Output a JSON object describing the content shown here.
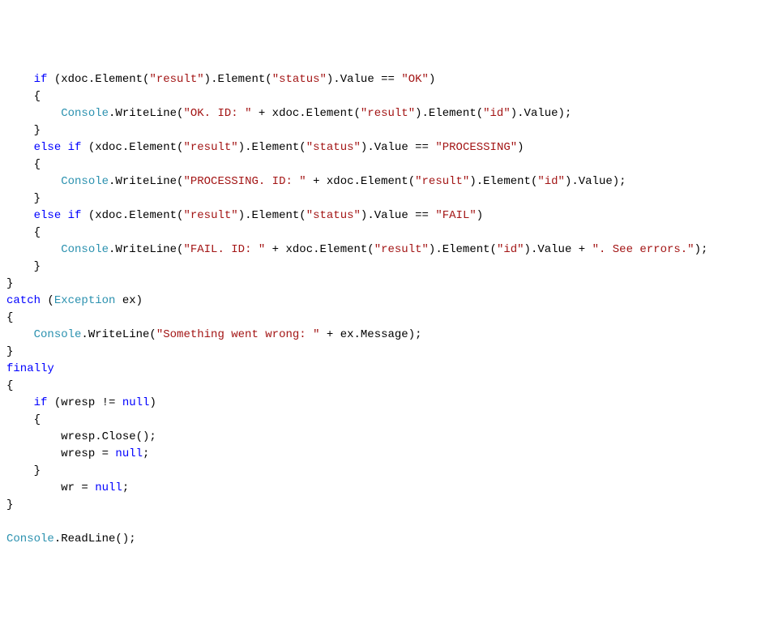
{
  "code": {
    "c": {
      "kw_if": "if",
      "kw_else": "else",
      "kw_catch": "catch",
      "kw_finally": "finally",
      "kw_null": "null",
      "type_exception": "Exception",
      "type_console": "Console"
    },
    "l1_a": " (xdoc.Element(",
    "l1_s1": "\"result\"",
    "l1_b": ").Element(",
    "l1_s2": "\"status\"",
    "l1_c": ").Value == ",
    "l1_s3": "\"OK\"",
    "l1_d": ")",
    "l2": "    {",
    "l3_a": "        ",
    "l3_b": ".WriteLine(",
    "l3_s1": "\"OK. ID: \"",
    "l3_c": " + xdoc.Element(",
    "l3_s2": "\"result\"",
    "l3_d": ").Element(",
    "l3_s3": "\"id\"",
    "l3_e": ").Value);",
    "l4": "    }",
    "l5_a": "    ",
    "l5_b": " ",
    "l5_c": " (xdoc.Element(",
    "l5_s1": "\"result\"",
    "l5_d": ").Element(",
    "l5_s2": "\"status\"",
    "l5_e": ").Value == ",
    "l5_s3": "\"PROCESSING\"",
    "l5_f": ")",
    "l6": "    {",
    "l7_a": "        ",
    "l7_b": ".WriteLine(",
    "l7_s1": "\"PROCESSING. ID: \"",
    "l7_c": " + xdoc.Element(",
    "l7_s2": "\"result\"",
    "l7_d": ").Element(",
    "l7_s3": "\"id\"",
    "l7_e": ").Value);",
    "l8": "    }",
    "l9_a": "    ",
    "l9_b": " ",
    "l9_c": " (xdoc.Element(",
    "l9_s1": "\"result\"",
    "l9_d": ").Element(",
    "l9_s2": "\"status\"",
    "l9_e": ").Value == ",
    "l9_s3": "\"FAIL\"",
    "l9_f": ")",
    "l10": "    {",
    "l11_a": "        ",
    "l11_b": ".WriteLine(",
    "l11_s1": "\"FAIL. ID: \"",
    "l11_c": " + xdoc.Element(",
    "l11_s2": "\"result\"",
    "l11_d": ").Element(",
    "l11_s3": "\"id\"",
    "l11_e": ").Value + ",
    "l11_s4": "\". See errors.\"",
    "l11_f": ");",
    "l12": "    }",
    "l13": "}",
    "l14_a": " (",
    "l14_b": " ex)",
    "l15": "{",
    "l16_a": "    ",
    "l16_b": ".WriteLine(",
    "l16_s1": "\"Something went wrong: \"",
    "l16_c": " + ex.Message);",
    "l17": "}",
    "l19": "{",
    "l20_a": "    ",
    "l20_b": " (wresp != ",
    "l20_c": ")",
    "l21": "    {",
    "l22": "        wresp.Close();",
    "l23_a": "        wresp = ",
    "l23_b": ";",
    "l24": "    }",
    "l25_a": "        wr = ",
    "l25_b": ";",
    "l26": "}",
    "blank": "",
    "l28_b": ".ReadLine();"
  }
}
